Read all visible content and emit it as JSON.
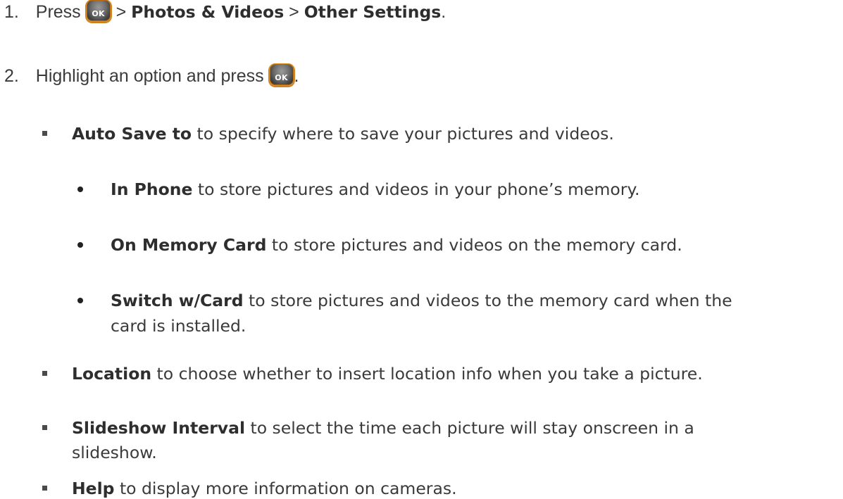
{
  "steps": [
    {
      "number": "1.",
      "press": "Press",
      "ok_label": "OK",
      "sep1": ">",
      "menu1": "Photos & Videos",
      "sep2": ">",
      "menu2": "Other Settings",
      "end": "."
    },
    {
      "number": "2.",
      "text": "Highlight an option and press",
      "ok_label": "OK",
      "end": "."
    }
  ],
  "options": {
    "auto_save": {
      "term": "Auto Save to",
      "desc": " to specify where to save your pictures and videos."
    },
    "in_phone": {
      "term": "In Phone",
      "desc": " to store pictures and videos in your phone’s memory."
    },
    "on_memory_card": {
      "term": "On Memory Card",
      "desc": " to store pictures and videos on the memory card."
    },
    "switch_card": {
      "term": "Switch w/Card",
      "desc": " to store pictures and videos to the memory card when the",
      "desc2": "card is installed."
    },
    "location": {
      "term": "Location",
      "desc": " to choose whether to insert location info when you take a picture."
    },
    "slideshow": {
      "term": "Slideshow Interval",
      "desc": " to select the time each picture will stay onscreen in a",
      "desc2": "slideshow."
    },
    "help": {
      "term": "Help",
      "desc": " to display more information on cameras."
    }
  }
}
